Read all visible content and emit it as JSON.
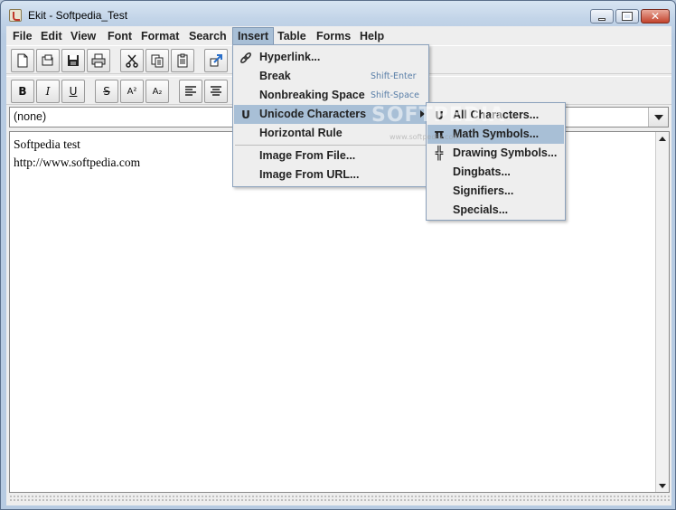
{
  "window": {
    "title": "Ekit - Softpedia_Test"
  },
  "menubar": [
    "File",
    "Edit",
    "View",
    "Font",
    "Format",
    "Search",
    "Insert",
    "Table",
    "Forms",
    "Help"
  ],
  "active_menu": "Insert",
  "combo": {
    "value": "(none)"
  },
  "editor": {
    "lines": [
      "Softpedia test",
      "http://www.softpedia.com"
    ]
  },
  "toolbar_format": {
    "bold": "B",
    "italic": "I",
    "underline": "U",
    "strike": "S",
    "superscript": "A²",
    "subscript": "A₂"
  },
  "insert_menu": {
    "items": [
      {
        "label": "Hyperlink...",
        "accel": "",
        "icon": "hyperlink-icon"
      },
      {
        "label": "Break",
        "accel": "Shift-Enter",
        "icon": ""
      },
      {
        "label": "Nonbreaking Space",
        "accel": "Shift-Space",
        "icon": ""
      },
      {
        "label": "Unicode Characters",
        "accel": "",
        "icon": "unicode-icon",
        "submenu": true,
        "highlighted": true
      },
      {
        "label": "Horizontal Rule",
        "accel": "",
        "icon": ""
      },
      {
        "label": "Image From File...",
        "accel": "",
        "icon": ""
      },
      {
        "label": "Image From URL...",
        "accel": "",
        "icon": ""
      }
    ]
  },
  "unicode_submenu": {
    "items": [
      {
        "label": "All Characters...",
        "icon": "unicode-icon"
      },
      {
        "label": "Math Symbols...",
        "icon": "pi-icon",
        "highlighted": true
      },
      {
        "label": "Drawing Symbols...",
        "icon": "box-drawing-icon"
      },
      {
        "label": "Dingbats...",
        "icon": ""
      },
      {
        "label": "Signifiers...",
        "icon": ""
      },
      {
        "label": "Specials...",
        "icon": ""
      }
    ]
  },
  "glyphs": {
    "unicode": "U",
    "pi": "π",
    "box_drawing": "╬",
    "close": "✕"
  },
  "watermark": {
    "text": "SOFTPEDIA",
    "url": "www.softpedia.com"
  },
  "colors": {
    "menu_highlight": "#a8bfd6",
    "accel_text": "#5a7fa8",
    "title_gradient": "#c2d4e8"
  }
}
